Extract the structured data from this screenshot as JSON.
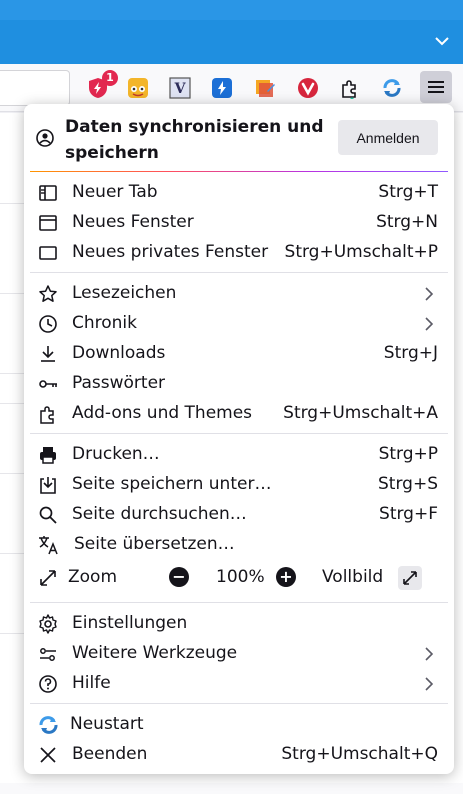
{
  "toolbar": {
    "extensions": [
      {
        "name": "ublock-icon",
        "badge": "1"
      },
      {
        "name": "stylus-icon"
      },
      {
        "name": "vimium-icon",
        "text": "V"
      },
      {
        "name": "bolt-icon"
      },
      {
        "name": "picture-edit-icon"
      },
      {
        "name": "vivaldi-icon"
      },
      {
        "name": "puzzle-extensions-icon"
      },
      {
        "name": "sync-tabs-icon"
      }
    ]
  },
  "menu": {
    "sync_text": "Daten synchronisieren und speichern",
    "sign_in": "Anmelden",
    "items": [
      {
        "label": "Neuer Tab",
        "shortcut": "Strg+T"
      },
      {
        "label": "Neues Fenster",
        "shortcut": "Strg+N"
      },
      {
        "label": "Neues privates Fenster",
        "shortcut": "Strg+Umschalt+P"
      },
      {
        "label": "Lesezeichen",
        "shortcut": ""
      },
      {
        "label": "Chronik",
        "shortcut": ""
      },
      {
        "label": "Downloads",
        "shortcut": "Strg+J"
      },
      {
        "label": "Passwörter",
        "shortcut": ""
      },
      {
        "label": "Add-ons und Themes",
        "shortcut": "Strg+Umschalt+A"
      },
      {
        "label": "Drucken…",
        "shortcut": "Strg+P"
      },
      {
        "label": "Seite speichern unter…",
        "shortcut": "Strg+S"
      },
      {
        "label": "Seite durchsuchen…",
        "shortcut": "Strg+F"
      },
      {
        "label": "Seite übersetzen…",
        "shortcut": ""
      },
      {
        "label": "Einstellungen",
        "shortcut": ""
      },
      {
        "label": "Weitere Werkzeuge",
        "shortcut": ""
      },
      {
        "label": "Hilfe",
        "shortcut": ""
      },
      {
        "label": "Neustart",
        "shortcut": ""
      },
      {
        "label": "Beenden",
        "shortcut": "Strg+Umschalt+Q"
      }
    ],
    "zoom": {
      "label": "Zoom",
      "value": "100%",
      "fullscreen": "Vollbild",
      "minus": "−",
      "plus": "+"
    }
  },
  "colors": {
    "titlebar": "#1f8fe0",
    "menu_button_active": "#cfcfd8"
  }
}
